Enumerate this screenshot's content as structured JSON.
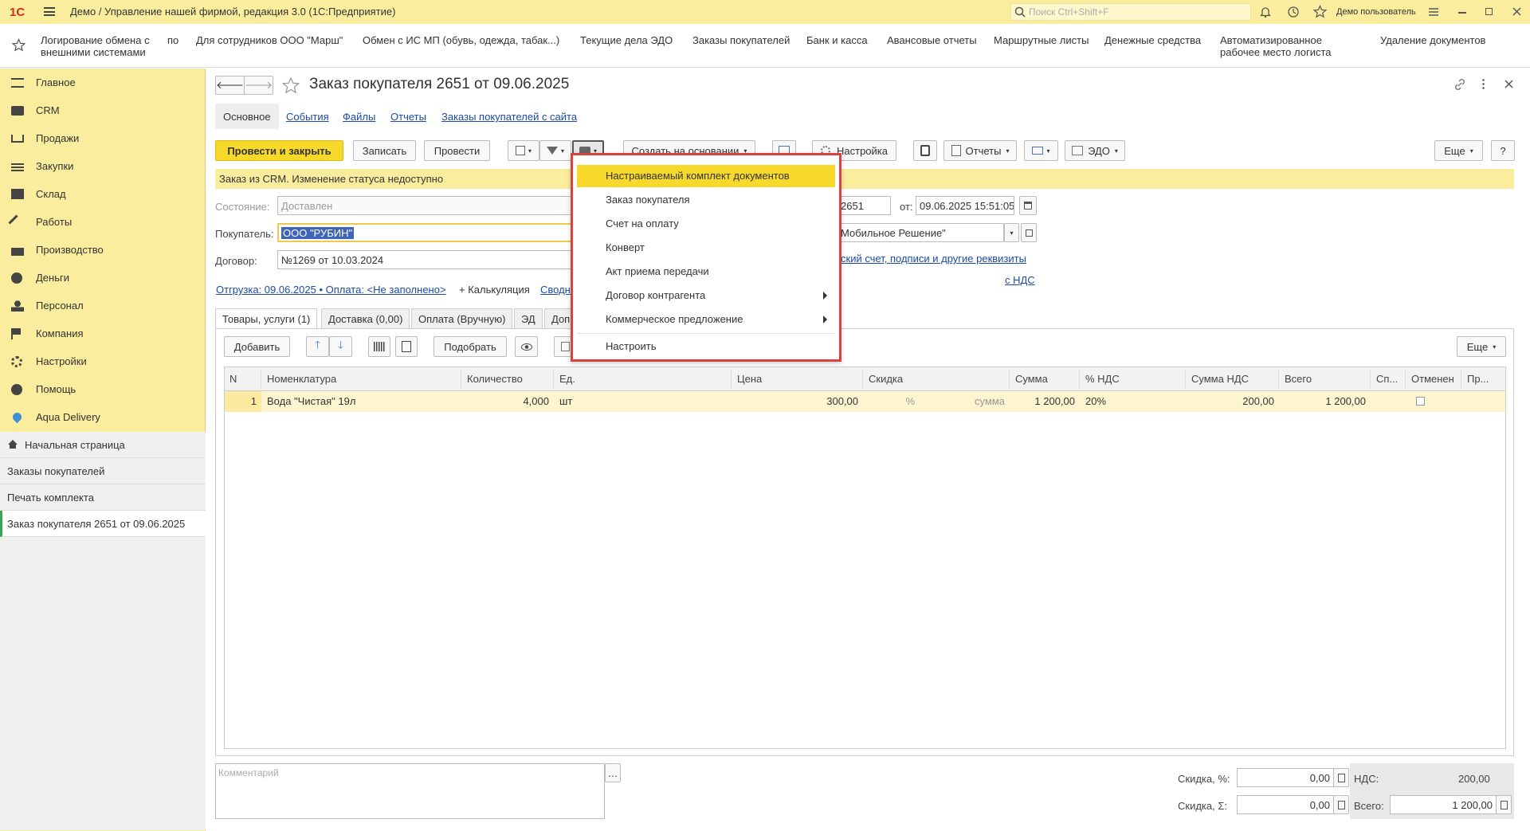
{
  "titlebar": {
    "title": "Демо / Управление нашей фирмой, редакция 3.0  (1С:Предприятие)",
    "search_placeholder": "Поиск Ctrl+Shift+F",
    "user": "Демо пользователь"
  },
  "quickbar": [
    "Логирование обмена с внешними системами",
    "по",
    "Для сотрудников ООО \"Марш\"",
    "Обмен с ИС МП (обувь, одежда, табак...)",
    "Текущие дела ЭДО",
    "Заказы покупателей",
    "Банк и касса",
    "Авансовые отчеты",
    "Маршрутные листы",
    "Денежные средства",
    "Автоматизированное рабочее место логиста",
    "Удаление документов"
  ],
  "sidebar": {
    "sections": [
      "Главное",
      "CRM",
      "Продажи",
      "Закупки",
      "Склад",
      "Работы",
      "Производство",
      "Деньги",
      "Персонал",
      "Компания",
      "Настройки",
      "Помощь",
      "Aqua Delivery"
    ],
    "open": [
      "Начальная страница",
      "Заказы покупателей",
      "Печать комплекта",
      "Заказ покупателя 2651 от 09.06.2025"
    ]
  },
  "doc": {
    "title": "Заказ покупателя 2651 от 09.06.2025",
    "nav": [
      "Основное",
      "События",
      "Файлы",
      "Отчеты",
      "Заказы покупателей с сайта"
    ],
    "toolbar": {
      "post_close": "Провести и закрыть",
      "save": "Записать",
      "post": "Провести",
      "create_based": "Создать на основании",
      "settings": "Настройка",
      "reports": "Отчеты",
      "edo": "ЭДО",
      "more": "Еще",
      "help": "?"
    },
    "notice": "Заказ из CRM. Изменение статуса недоступно",
    "state_label": "Состояние:",
    "state_value": "Доставлен",
    "number_value": "2651",
    "date_label": "от:",
    "date_value": "09.06.2025 15:51:05",
    "buyer_label": "Покупатель:",
    "buyer_value": "ООО \"РУБИН\"",
    "org_value": "Мобильное Решение\"",
    "contract_label": "Договор:",
    "contract_value": "№1269 от 10.03.2024",
    "bank_link": "ский счет, подписи и другие реквизиты",
    "vat_link": "с НДС",
    "shipment_link": "Отгрузка: 09.06.2025 • Оплата: <Не заполнено>",
    "calc_link": "+ Калькуляция",
    "summary_link": "Сводн"
  },
  "tabs": [
    "Товары, услуги (1)",
    "Доставка (0,00)",
    "Оплата (Вручную)",
    "ЭД",
    "Доп"
  ],
  "table_toolbar": {
    "add": "Добавить",
    "pick": "Подобрать",
    "more": "Еще"
  },
  "table": {
    "columns": [
      "N",
      "Номенклатура",
      "Количество",
      "Ед.",
      "Цена",
      "Скидка",
      "Сумма",
      "% НДС",
      "Сумма НДС",
      "Всего",
      "Сп...",
      "Отменен",
      "Пр..."
    ],
    "rows": [
      {
        "n": "1",
        "item": "Вода \"Чистая\" 19л",
        "qty": "4,000",
        "unit": "шт",
        "price": "300,00",
        "disc_pct": "%",
        "disc_sum": "сумма",
        "sum": "1 200,00",
        "vat_rate": "20%",
        "vat_sum": "200,00",
        "total": "1 200,00"
      }
    ]
  },
  "footer": {
    "comment_placeholder": "Комментарий",
    "disc_pct_label": "Скидка, %:",
    "disc_pct_value": "0,00",
    "disc_sum_label": "Скидка, Σ:",
    "disc_sum_value": "0,00",
    "vat_label": "НДС:",
    "vat_value": "200,00",
    "total_label": "Всего:",
    "total_value": "1 200,00"
  },
  "print_menu": [
    {
      "label": "Настраиваемый комплект документов",
      "highlight": true
    },
    {
      "label": "Заказ покупателя"
    },
    {
      "label": "Счет на оплату"
    },
    {
      "label": "Конверт"
    },
    {
      "label": "Акт приема передачи"
    },
    {
      "label": "Договор контрагента",
      "submenu": true
    },
    {
      "label": "Коммерческое предложение",
      "submenu": true
    },
    {
      "label": "Настроить"
    }
  ],
  "colors": {
    "accent_yellow": "#f7d92c",
    "bar_yellow": "#fbed9e",
    "menu_border": "#d9433e",
    "link": "#1a4ba5"
  }
}
